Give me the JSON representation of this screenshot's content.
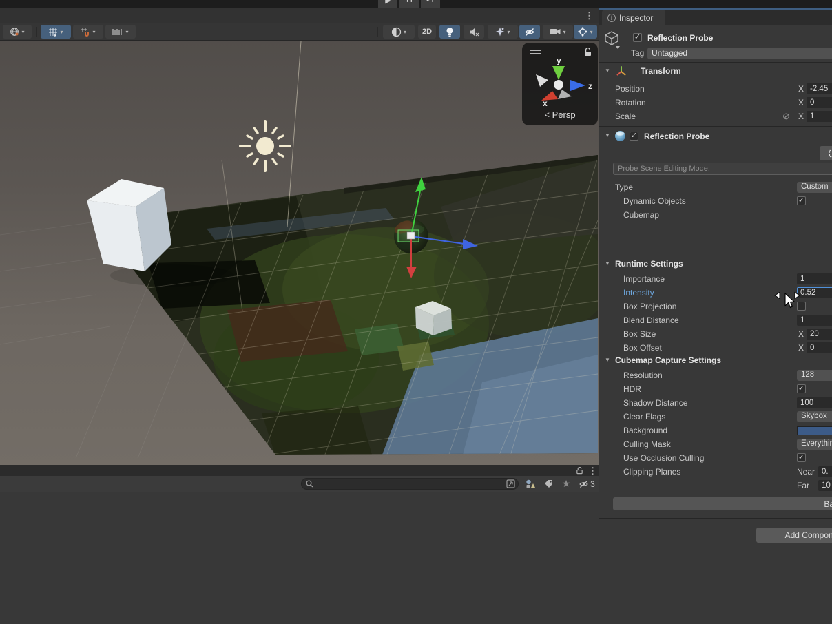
{
  "main_toolbar": {
    "play_icon": "▶",
    "pause_icon": "❙❙",
    "step_icon": "▶❙"
  },
  "scene_toolbar": {
    "mode_2d_label": "2D",
    "menu_icon": "⋮"
  },
  "scene_gizmo": {
    "axis_x": "x",
    "axis_y": "y",
    "axis_z": "z",
    "persp_label": "< Persp"
  },
  "inspector": {
    "tab_label": "Inspector",
    "info_glyph": "i",
    "game_object": {
      "name": "Reflection Probe",
      "tag_label": "Tag",
      "tag_value": "Untagged"
    },
    "transform": {
      "title": "Transform",
      "position": {
        "label": "Position",
        "axis": "X",
        "value": "-2.45"
      },
      "rotation": {
        "label": "Rotation",
        "axis": "X",
        "value": "0"
      },
      "scale": {
        "label": "Scale",
        "axis": "X",
        "value": "1",
        "unlink_icon": "⊘"
      }
    },
    "reflection_probe": {
      "title": "Reflection Probe",
      "editing_mode_label": "Probe Scene Editing Mode:",
      "type": {
        "label": "Type",
        "value": "Custom"
      },
      "dynamic_objects": {
        "label": "Dynamic Objects",
        "check": "✓"
      },
      "cubemap": {
        "label": "Cubemap"
      },
      "runtime": {
        "title": "Runtime Settings",
        "importance": {
          "label": "Importance",
          "value": "1"
        },
        "intensity": {
          "label": "Intensity",
          "value": "0.52"
        },
        "box_projection": {
          "label": "Box Projection",
          "check": ""
        },
        "blend_distance": {
          "label": "Blend Distance",
          "value": "1"
        },
        "box_size": {
          "label": "Box Size",
          "axis": "X",
          "value": "20"
        },
        "box_offset": {
          "label": "Box Offset",
          "axis": "X",
          "value": "0"
        }
      },
      "capture": {
        "title": "Cubemap Capture Settings",
        "resolution": {
          "label": "Resolution",
          "value": "128"
        },
        "hdr": {
          "label": "HDR",
          "check": "✓"
        },
        "shadow_distance": {
          "label": "Shadow Distance",
          "value": "100"
        },
        "clear_flags": {
          "label": "Clear Flags",
          "value": "Skybox"
        },
        "background": {
          "label": "Background",
          "color": "#3C5B88"
        },
        "culling_mask": {
          "label": "Culling Mask",
          "value": "Everything"
        },
        "use_occlusion": {
          "label": "Use Occlusion Culling",
          "check": "✓"
        },
        "clipping": {
          "label": "Clipping Planes",
          "near_label": "Near",
          "near_value": "0.",
          "far_label": "Far",
          "far_value": "10"
        }
      },
      "bake_label": "Bake"
    },
    "add_component_label": "Add Component"
  },
  "project_panel": {
    "search_value": "",
    "hidden_count": "3",
    "menu_icon": "⋮",
    "star_icon": "★"
  },
  "colors": {
    "toggle_active": "#46607C",
    "selected_field_border": "#4F90D9",
    "background_swatch": "#3C5B88",
    "intensity_label": "#6FA9E2"
  }
}
